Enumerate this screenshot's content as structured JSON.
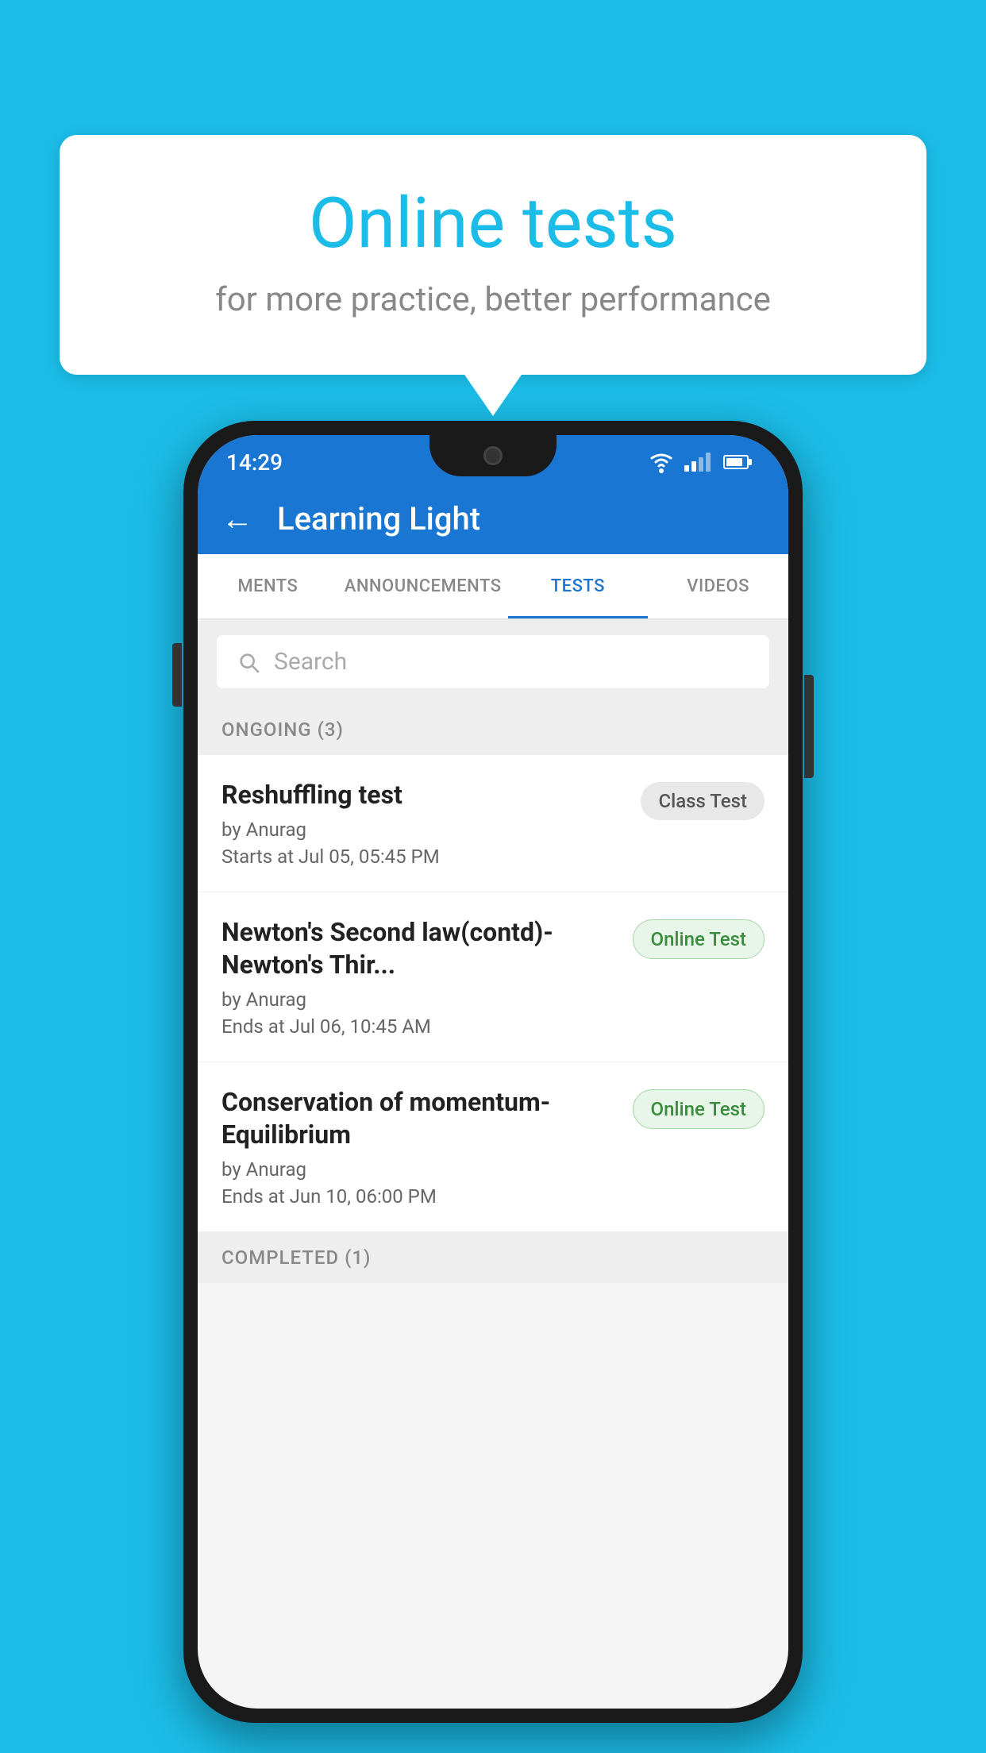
{
  "background": {
    "color": "#1BBDE8"
  },
  "speech_bubble": {
    "title": "Online tests",
    "subtitle": "for more practice, better performance"
  },
  "phone": {
    "status_bar": {
      "time": "14:29"
    },
    "app_bar": {
      "back_label": "←",
      "title": "Learning Light"
    },
    "tabs": [
      {
        "label": "MENTS",
        "active": false
      },
      {
        "label": "ANNOUNCEMENTS",
        "active": false
      },
      {
        "label": "TESTS",
        "active": true
      },
      {
        "label": "VIDEOS",
        "active": false
      }
    ],
    "search": {
      "placeholder": "Search"
    },
    "ongoing_section": {
      "header": "ONGOING (3)",
      "tests": [
        {
          "title": "Reshuffling test",
          "author": "by Anurag",
          "time": "Starts at  Jul 05, 05:45 PM",
          "badge": "Class Test",
          "badge_type": "class"
        },
        {
          "title": "Newton's Second law(contd)-Newton's Thir...",
          "author": "by Anurag",
          "time": "Ends at  Jul 06, 10:45 AM",
          "badge": "Online Test",
          "badge_type": "online"
        },
        {
          "title": "Conservation of momentum-Equilibrium",
          "author": "by Anurag",
          "time": "Ends at  Jun 10, 06:00 PM",
          "badge": "Online Test",
          "badge_type": "online"
        }
      ]
    },
    "completed_section": {
      "header": "COMPLETED (1)"
    }
  }
}
